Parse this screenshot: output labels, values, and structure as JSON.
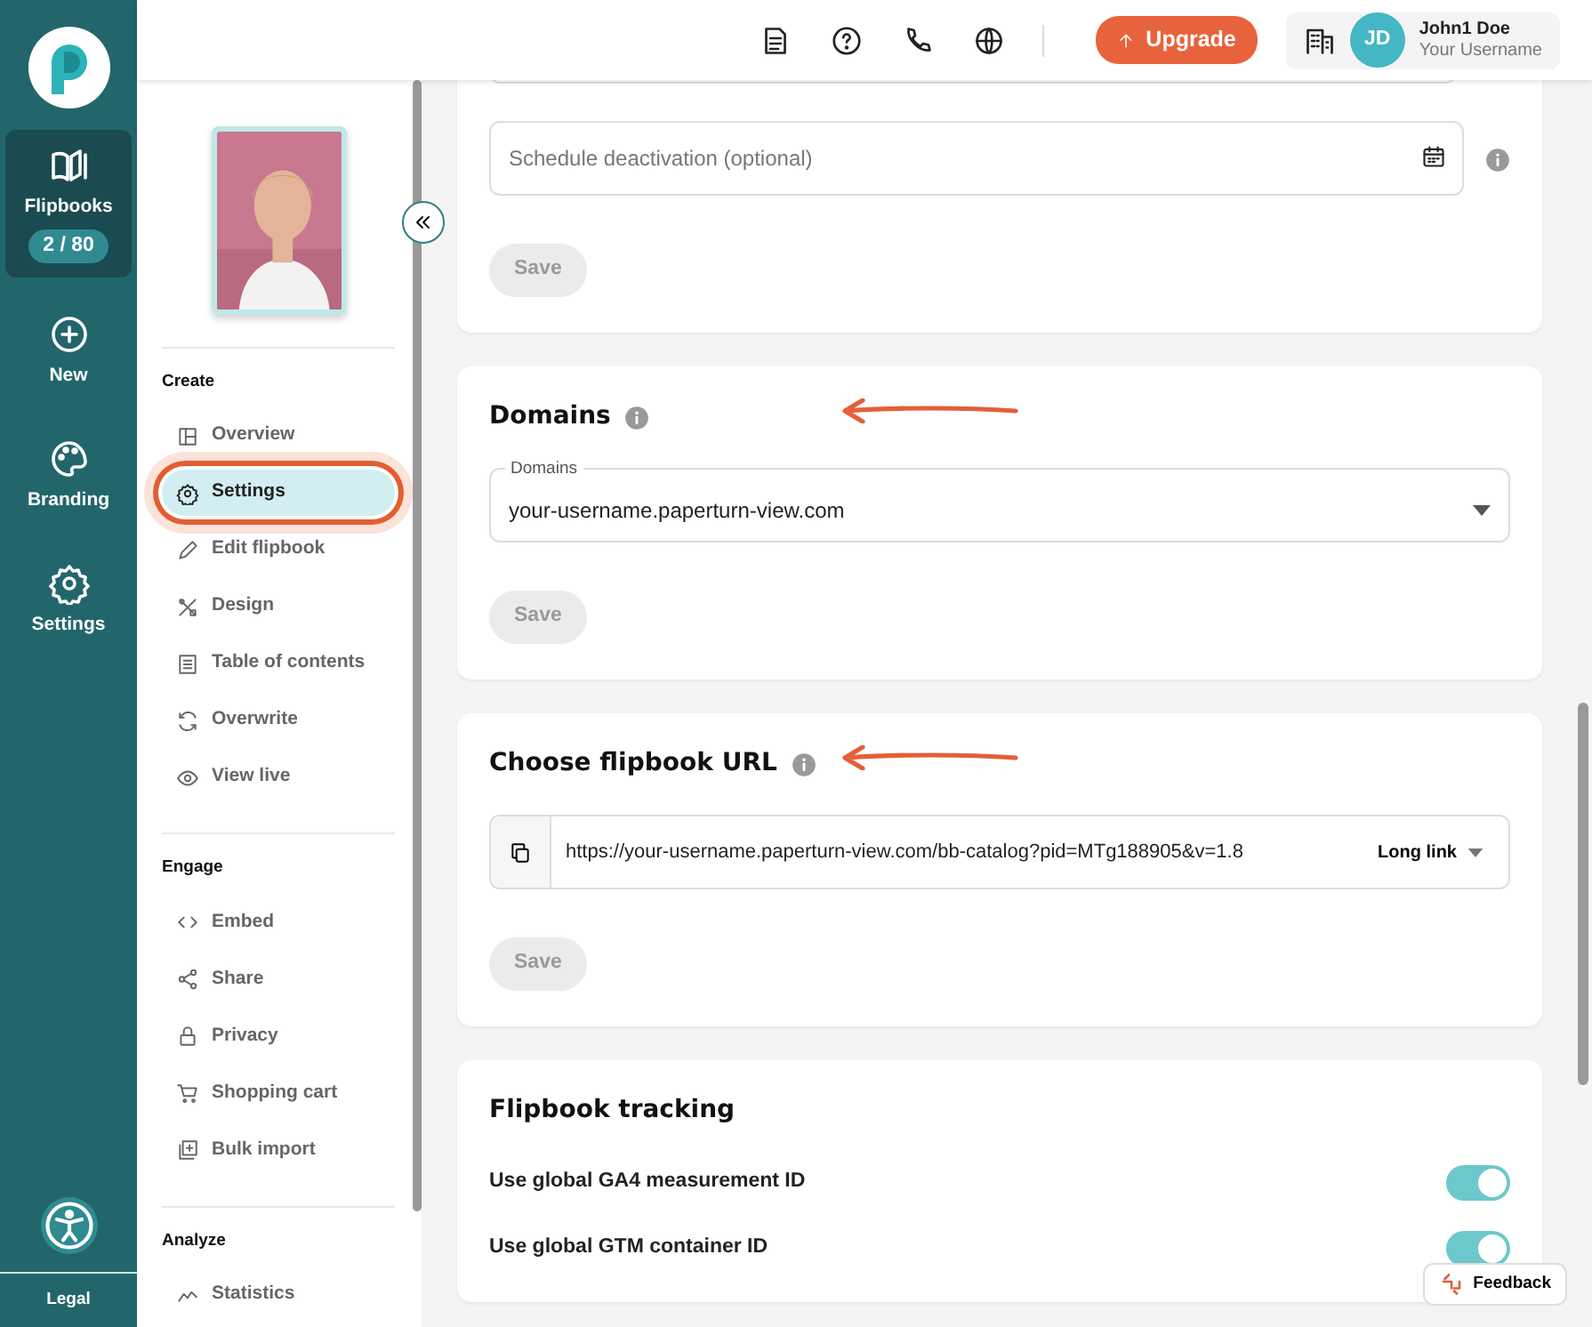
{
  "rail": {
    "items": [
      {
        "label": "Flipbooks",
        "badge": "2 / 80",
        "selected": true
      },
      {
        "label": "New",
        "selected": false
      },
      {
        "label": "Branding",
        "selected": false
      },
      {
        "label": "Settings",
        "selected": false
      }
    ],
    "footer": "Legal"
  },
  "header": {
    "upgrade": "Upgrade",
    "avatar": "JD",
    "user_name": "John1 Doe",
    "username": "Your Username"
  },
  "sidebar": {
    "sections": [
      {
        "title": "Create",
        "items": [
          {
            "label": "Overview",
            "selected": false,
            "highlighted": false
          },
          {
            "label": "Settings",
            "selected": true,
            "highlighted": true
          },
          {
            "label": "Edit flipbook",
            "selected": false,
            "highlighted": false
          },
          {
            "label": "Design",
            "selected": false,
            "highlighted": false
          },
          {
            "label": "Table of contents",
            "selected": false,
            "highlighted": false
          },
          {
            "label": "Overwrite",
            "selected": false,
            "highlighted": false
          },
          {
            "label": "View live",
            "selected": false,
            "highlighted": false
          }
        ]
      },
      {
        "title": "Engage",
        "items": [
          {
            "label": "Embed",
            "selected": false,
            "highlighted": false
          },
          {
            "label": "Share",
            "selected": false,
            "highlighted": false
          },
          {
            "label": "Privacy",
            "selected": false,
            "highlighted": false
          },
          {
            "label": "Shopping cart",
            "selected": false,
            "highlighted": false
          },
          {
            "label": "Bulk import",
            "selected": false,
            "highlighted": false
          }
        ]
      },
      {
        "title": "Analyze",
        "items": [
          {
            "label": "Statistics",
            "selected": false,
            "highlighted": false
          }
        ]
      }
    ]
  },
  "cards": [
    {
      "kind": "schedule",
      "placeholder": "Schedule deactivation (optional)",
      "save": {
        "label": "Save",
        "disabled": true
      }
    },
    {
      "kind": "select",
      "title": "Domains",
      "annotated": true,
      "field_label": "Domains",
      "value": "your-username.paperturn-view.com",
      "save": {
        "label": "Save",
        "disabled": true
      }
    },
    {
      "kind": "url",
      "title": "Choose flipbook URL",
      "annotated": true,
      "value": "https://your-username.paperturn-view.com/bb-catalog?pid=MTg188905&v=1.8",
      "link_type": "Long link",
      "save": {
        "label": "Save",
        "disabled": true
      }
    },
    {
      "kind": "toggles",
      "title": "Flipbook tracking",
      "annotated": false,
      "toggles": [
        {
          "label": "Use global GA4 measurement ID",
          "on": true
        },
        {
          "label": "Use global GTM container ID",
          "on": true
        }
      ]
    }
  ],
  "feedback": "Feedback"
}
